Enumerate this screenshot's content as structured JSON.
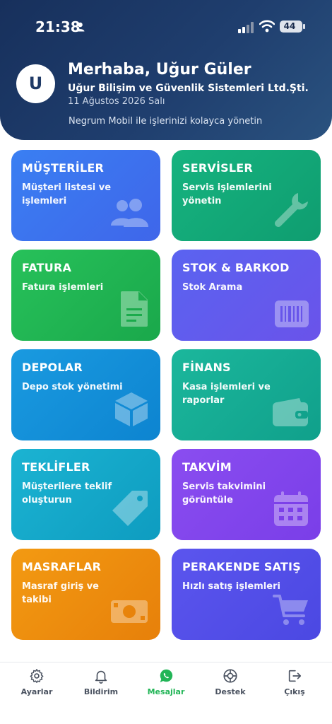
{
  "status_bar": {
    "time": "21:38",
    "battery": "44"
  },
  "header": {
    "avatar_letter": "U",
    "greeting": "Merhaba, Uğur Güler",
    "company": "Uğur Bilişim ve Güvenlik Sistemleri Ltd.Şti.",
    "date": "11 Ağustos 2026 Salı",
    "tagline": "Negrum Mobil ile işlerinizi kolayca yönetin"
  },
  "cards": [
    {
      "title": "MÜŞTERİLER",
      "subtitle": "Müşteri listesi ve işlemleri",
      "icon": "users-icon",
      "color": "#3a7ff2"
    },
    {
      "title": "SERVİSLER",
      "subtitle": "Servis işlemlerini yönetin",
      "icon": "wrench-icon",
      "color": "#16b37f"
    },
    {
      "title": "FATURA",
      "subtitle": "Fatura işlemleri",
      "icon": "document-icon",
      "color": "#27c15a"
    },
    {
      "title": "STOK & BARKOD",
      "subtitle": "Stok Arama",
      "icon": "barcode-icon",
      "color": "#5a63f0"
    },
    {
      "title": "DEPOLAR",
      "subtitle": "Depo stok yönetimi",
      "icon": "box-icon",
      "color": "#1a9ae0"
    },
    {
      "title": "FİNANS",
      "subtitle": "Kasa işlemleri ve raporlar",
      "icon": "wallet-icon",
      "color": "#1bb79c"
    },
    {
      "title": "TEKLİFLER",
      "subtitle": "Müşterilere teklif oluşturun",
      "icon": "tag-icon",
      "color": "#1bb3d2"
    },
    {
      "title": "TAKVİM",
      "subtitle": "Servis takvimini görüntüle",
      "icon": "calendar-icon",
      "color": "#8a4df0"
    },
    {
      "title": "MASRAFLAR",
      "subtitle": "Masraf giriş ve takibi",
      "icon": "money-icon",
      "color": "#f39a12"
    },
    {
      "title": "PERAKENDE SATIŞ",
      "subtitle": "Hızlı satış işlemleri",
      "icon": "cart-icon",
      "color": "#5b55ee"
    }
  ],
  "bottom_nav": [
    {
      "label": "Ayarlar",
      "icon": "gear-icon"
    },
    {
      "label": "Bildirim",
      "icon": "bell-icon"
    },
    {
      "label": "Mesajlar",
      "icon": "whatsapp-icon",
      "active": true
    },
    {
      "label": "Destek",
      "icon": "lifebuoy-icon"
    },
    {
      "label": "Çıkış",
      "icon": "logout-icon"
    }
  ]
}
